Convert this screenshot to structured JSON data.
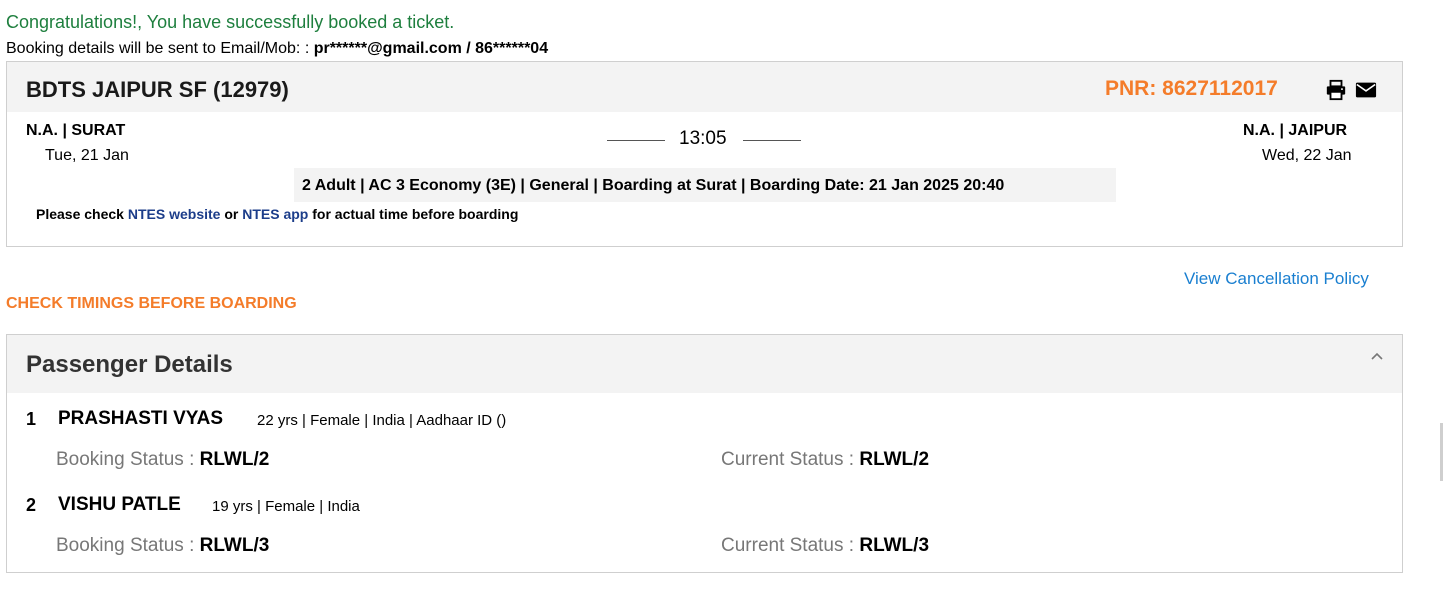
{
  "confirmation": {
    "message": "Congratulations!, You have successfully booked a ticket.",
    "details_prefix": "Booking details will be sent to Email/Mob: : ",
    "contact": "pr******@gmail.com / 86******04"
  },
  "train": {
    "name": "BDTS JAIPUR SF (12979)",
    "pnr": "PNR: 8627112017",
    "from": {
      "code": "N.A. | SURAT",
      "date": "Tue, 21 Jan"
    },
    "to": {
      "code": "N.A. | JAIPUR",
      "date": "Wed, 22 Jan"
    },
    "time": "13:05",
    "class_info": "2 Adult | AC 3 Economy (3E) | General | Boarding at Surat | Boarding Date: 21 Jan 2025 20:40",
    "check_prefix": "Please check ",
    "ntes_website": "NTES website",
    "or_text": " or ",
    "ntes_app": "NTES app",
    "check_suffix": " for actual time before boarding"
  },
  "links": {
    "cancellation_policy": "View Cancellation Policy",
    "check_timings": "CHECK TIMINGS BEFORE BOARDING"
  },
  "passengers": {
    "title": "Passenger Details",
    "booking_status_label": "Booking Status : ",
    "current_status_label": "Current Status : ",
    "list": [
      {
        "num": "1",
        "name": "PRASHASTI VYAS",
        "info": "22 yrs | Female | India | Aadhaar ID ()",
        "booking_status": "RLWL/2",
        "current_status": "RLWL/2"
      },
      {
        "num": "2",
        "name": "VISHU PATLE",
        "info": "19 yrs | Female | India",
        "booking_status": "RLWL/3",
        "current_status": "RLWL/3"
      }
    ]
  },
  "icons": {
    "print": "print-icon",
    "mail": "mail-icon",
    "collapse": "chevron-up-icon"
  },
  "colors": {
    "success": "#1e7f3e",
    "accent": "#f47c2a",
    "link": "#1a7fd0",
    "ntes_link": "#1c3d8a"
  }
}
